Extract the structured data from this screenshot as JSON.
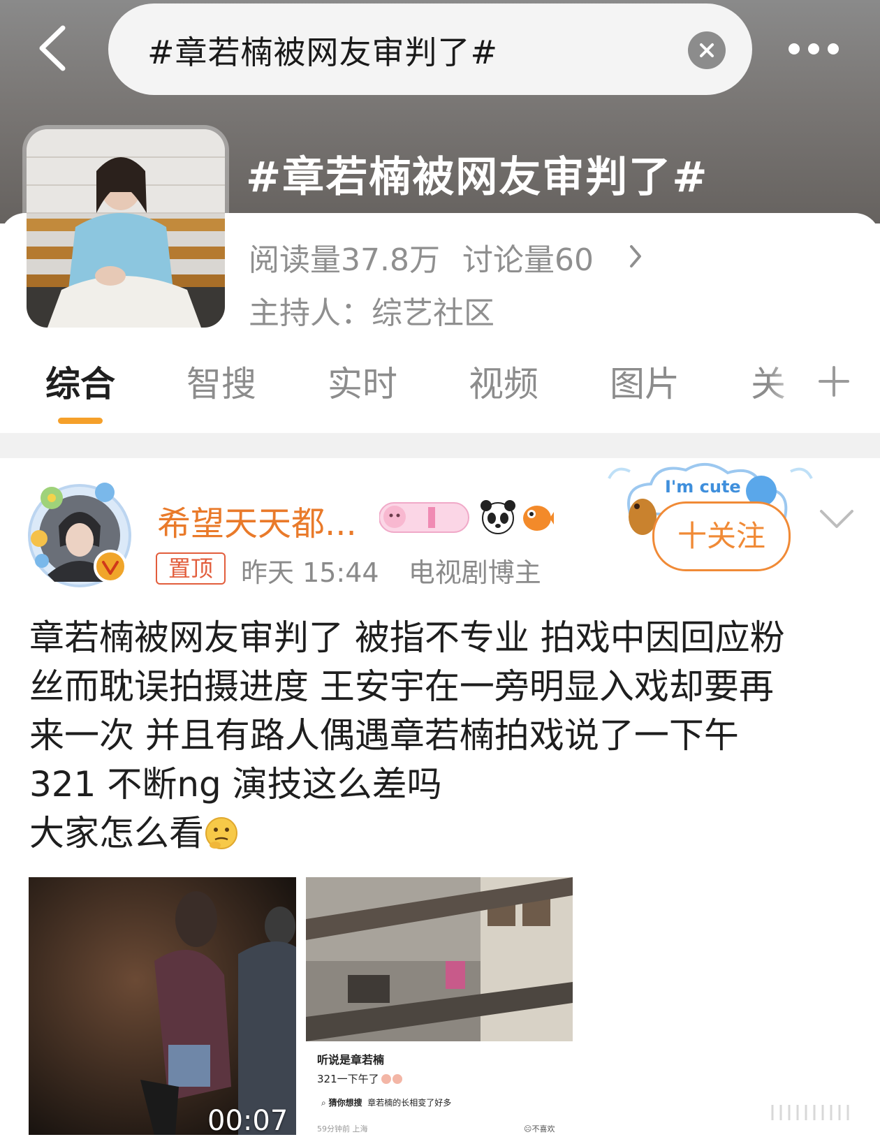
{
  "header": {
    "search_query": "#章若楠被网友审判了#",
    "topic_title": "#章若楠被网友审判了#"
  },
  "topic": {
    "reads_label": "阅读量37.8万",
    "discussions_label": "讨论量60",
    "host_label": "主持人：综艺社区"
  },
  "tabs": [
    {
      "label": "综合",
      "active": true
    },
    {
      "label": "智搜",
      "active": false
    },
    {
      "label": "实时",
      "active": false
    },
    {
      "label": "视频",
      "active": false
    },
    {
      "label": "图片",
      "active": false
    },
    {
      "label": "关",
      "active": false
    }
  ],
  "post": {
    "username": "希望天天都...",
    "pin_label": "置顶",
    "time": "昨天 15:44",
    "role": "电视剧博主",
    "follow_label": "十关注",
    "decor_text": "I'm cute",
    "body_lines": [
      "章若楠被网友审判了 被指不专业  拍戏中因回应粉",
      "丝而耽误拍摄进度   王安宇在一旁明显入戏却要再",
      "来一次   并且有路人偶遇章若楠拍戏说了一下午",
      "321  不断ng  演技这么差吗",
      "大家怎么看"
    ],
    "video_duration": "00:07"
  },
  "screenshot": {
    "title": "听说是章若楠",
    "subtitle": "321一下午了",
    "search_label": "猜你想搜",
    "search_term": "章若楠的长相变了好多",
    "footer_left": "59分钟前 上海",
    "footer_right": "不喜欢"
  },
  "colors": {
    "accent_orange": "#e97a2a",
    "tab_indicator": "#f5a02a",
    "pin_red": "#e25d3c"
  }
}
